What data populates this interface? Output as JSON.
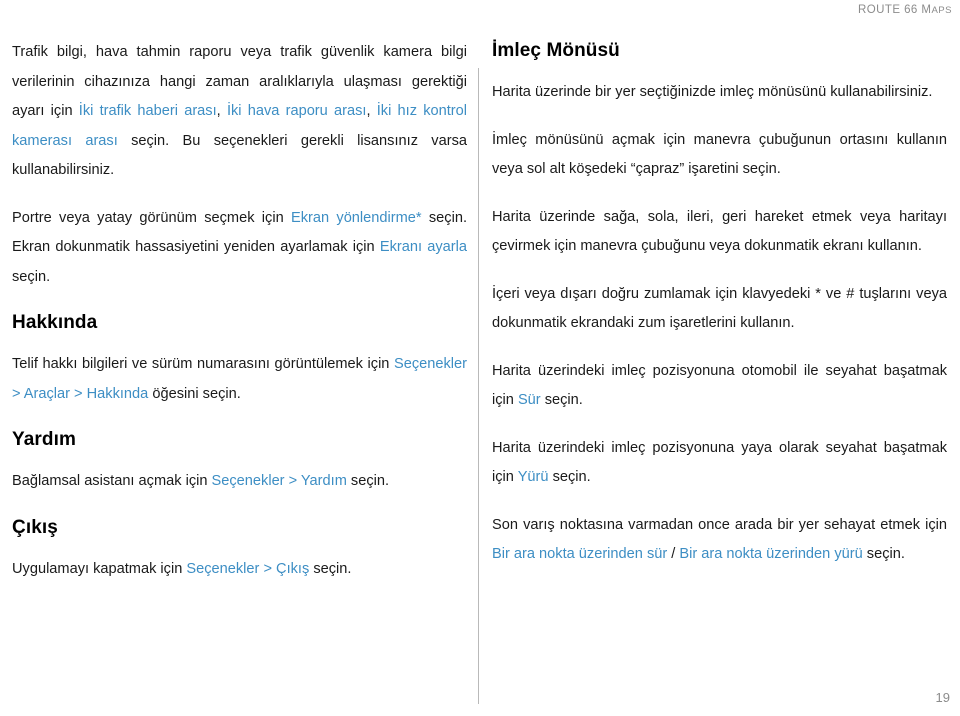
{
  "header": {
    "brand_first": "ROUTE 66 ",
    "brand_small_m": "M",
    "brand_small_rest": "APS"
  },
  "footer": {
    "page_number": "19"
  },
  "colors": {
    "link": "#3d8ec4",
    "text": "#1a1a1a",
    "header_gray": "#8c8c8c",
    "divider": "#b9b9b9"
  },
  "left_column": {
    "p1": {
      "s1": "Trafik bilgi, hava tahmin raporu veya trafik güvenlik kamera bilgi verilerinin cihazınıza hangi zaman aralıklarıyla ulaşması gerektiği ayarı için ",
      "l1": "İki trafik haberi arası",
      "s2": ", ",
      "l2": "İki hava raporu arası",
      "s3": ", ",
      "l3": "İki hız kontrol kamerası arası",
      "s4": " seçin. Bu seçenekleri gerekli lisansınız varsa kullanabilirsiniz."
    },
    "p2": {
      "s1": "Portre veya yatay görünüm seçmek için ",
      "l1": "Ekran yönlendirme*",
      "s2": " seçin. Ekran dokunmatik hassasiyetini yeniden ayarlamak için ",
      "l2": "Ekranı ayarla",
      "s3": " seçin."
    },
    "h_about": "Hakkında",
    "p3": {
      "s1": "Telif hakkı bilgileri ve sürüm numarasını görüntülemek için ",
      "l1": "Seçenekler > Araçlar > Hakkında",
      "s2": " öğesini seçin."
    },
    "h_help": "Yardım",
    "p4": {
      "s1": "Bağlamsal asistanı açmak için ",
      "l1": "Seçenekler > Yardım",
      "s2": " seçin."
    },
    "h_exit": "Çıkış",
    "p5": {
      "s1": "Uygulamayı kapatmak için ",
      "l1": "Seçenekler > Çıkış",
      "s2": " seçin."
    }
  },
  "right_column": {
    "h_cursor_menu": "İmleç Mönüsü",
    "p1": "Harita üzerinde bir yer seçtiğinizde imleç mönüsünü kullanabilirsiniz.",
    "p2": "İmleç mönüsünü açmak için manevra çubuğunun ortasını kullanın veya sol alt köşedeki “çapraz” işaretini seçin.",
    "p3": "Harita üzerinde sağa, sola, ileri, geri hareket etmek veya haritayı çevirmek için manevra çubuğunu veya dokunmatik ekranı kullanın.",
    "p4": "İçeri veya dışarı doğru zumlamak için klavyedeki * ve # tuşlarını veya dokunmatik ekrandaki zum işaretlerini kullanın.",
    "p5": {
      "s1": "Harita üzerindeki imleç pozisyonuna otomobil ile seyahat başatmak için ",
      "l1": "Sür",
      "s2": " seçin."
    },
    "p6": {
      "s1": "Harita üzerindeki imleç pozisyonuna yaya olarak seyahat başatmak için ",
      "l1": "Yürü",
      "s2": " seçin."
    },
    "p7": {
      "s1": "Son varış noktasına varmadan once arada bir yer sehayat etmek için ",
      "l1": "Bir ara nokta üzerinden sür",
      "s2": " / ",
      "l2": "Bir ara nokta üzerinden yürü",
      "s3": " seçin."
    }
  }
}
